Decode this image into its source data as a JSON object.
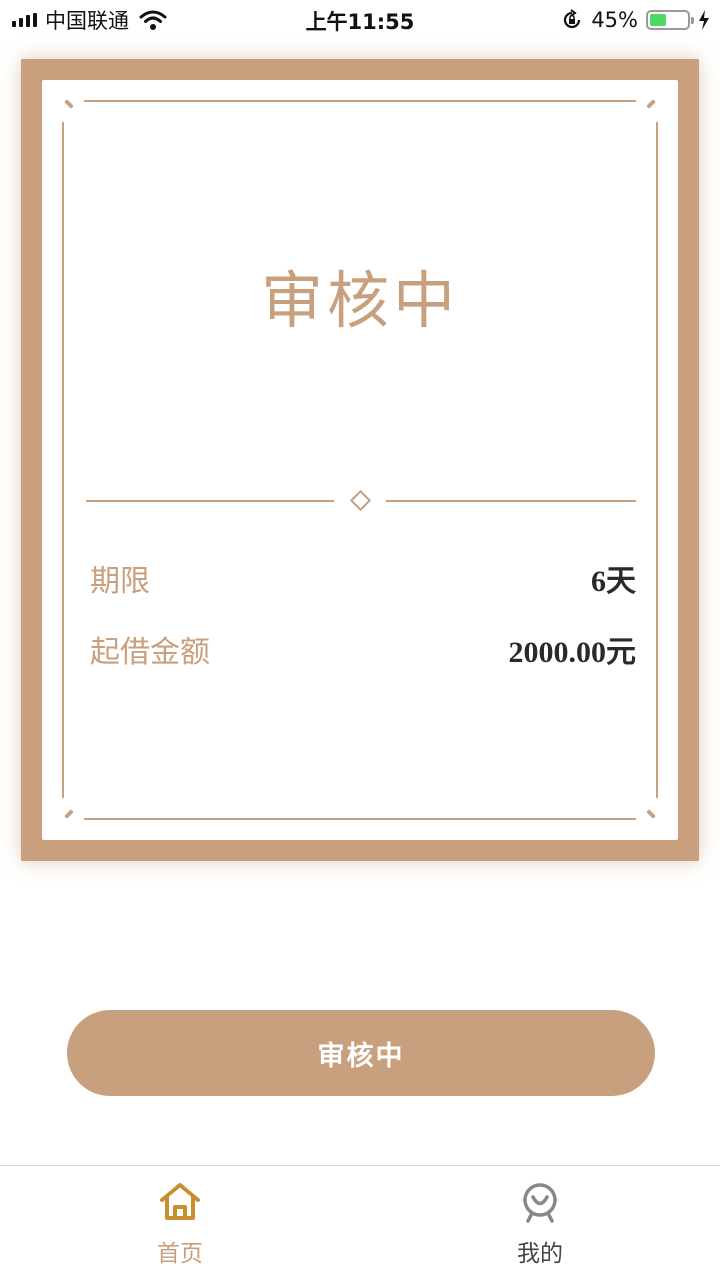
{
  "status_bar": {
    "carrier": "中国联通",
    "time": "上午11:55",
    "battery_percent": "45%",
    "battery_level": 0.45,
    "icons": [
      "signal-icon",
      "wifi-icon",
      "rotation-lock-icon",
      "battery-icon",
      "charging-icon"
    ]
  },
  "card": {
    "status_title": "审核中",
    "rows": [
      {
        "label": "期限",
        "value": "6天"
      },
      {
        "label": "起借金额",
        "value": "2000.00元"
      }
    ]
  },
  "action_button": {
    "label": "审核中"
  },
  "tab_bar": {
    "tabs": [
      {
        "label": "首页",
        "icon": "home-icon",
        "active": true
      },
      {
        "label": "我的",
        "icon": "profile-icon",
        "active": false
      }
    ]
  },
  "colors": {
    "accent": "#c9a07e",
    "text_dark": "#2a2a2a",
    "battery_green": "#4cd964"
  }
}
